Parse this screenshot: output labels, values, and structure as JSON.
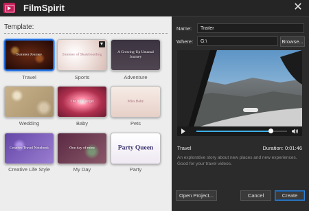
{
  "window": {
    "title": "FilmSpirit",
    "close_glyph": "✕"
  },
  "colors": {
    "accent": "#1f6fe0",
    "title_bar": "#252526",
    "left_pane": "#ededed",
    "right_pane": "#2b2b2b",
    "seek_fill": "#3db0e8"
  },
  "template_panel": {
    "heading": "Template:",
    "templates": [
      {
        "label": "Travel",
        "thumb_text": "Summer Journey",
        "selected": true
      },
      {
        "label": "Sports",
        "thumb_text": "Summer of Skateboarding",
        "badge_icon": "download-icon"
      },
      {
        "label": "Adventure",
        "thumb_text": "A Growing-Up Unusual Journey"
      },
      {
        "label": "Wedding",
        "thumb_text": ""
      },
      {
        "label": "Baby",
        "thumb_text": "The little Angel"
      },
      {
        "label": "Pets",
        "thumb_text": "Miss Baby"
      },
      {
        "label": "Creative Life Style",
        "thumb_text": "Creative Travel Notebook"
      },
      {
        "label": "My Day",
        "thumb_text": "One day of mine"
      },
      {
        "label": "Party",
        "thumb_text": "Party Queen"
      }
    ]
  },
  "project": {
    "name_label": "Name:",
    "name_value": "Trailer",
    "where_label": "Where:",
    "where_value": "G:\\",
    "browse_label": "Browse..."
  },
  "player": {
    "progress": 0.82,
    "play_icon": "play-icon",
    "volume_icon": "volume-icon"
  },
  "template_info": {
    "title": "Travel",
    "duration_label": "Duration:",
    "duration_value": "0:01:46",
    "description": "An explorative story about new places and new experiences. Good for your travel videos."
  },
  "footer": {
    "open_project_label": "Open Project...",
    "cancel_label": "Cancel",
    "create_label": "Create"
  }
}
